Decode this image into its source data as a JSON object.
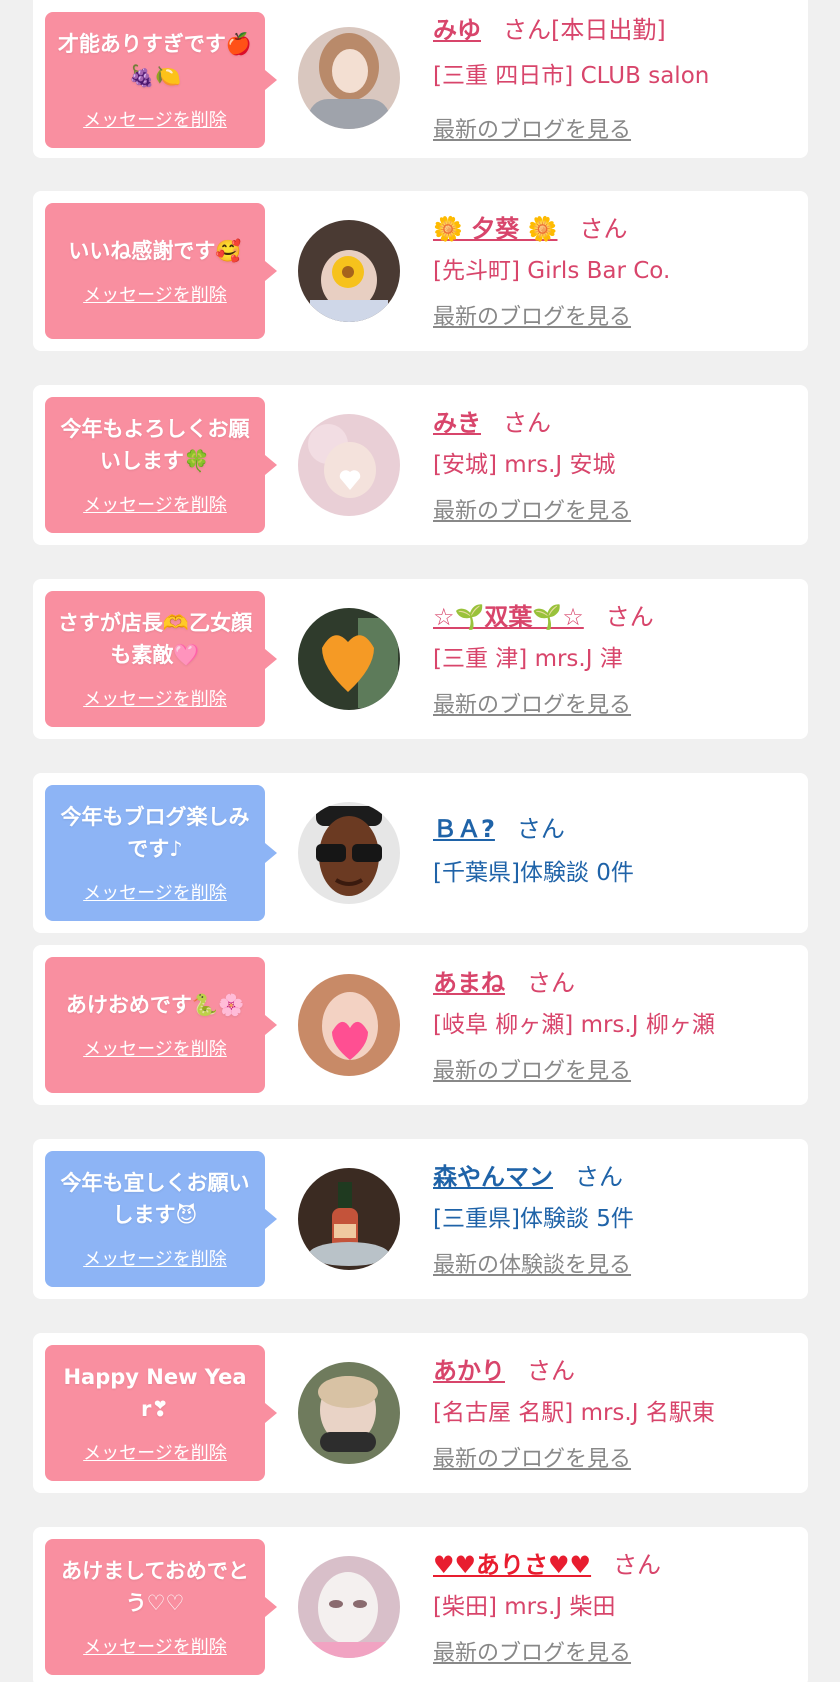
{
  "messages": [
    {
      "bubble_text": "才能ありすぎです🍎🍇🍋",
      "bubble_color": "pink",
      "delete_label": "メッセージを削除",
      "name": "みゆ",
      "honorific": "さん[本日出勤]",
      "shop": "[三重 四日市] CLUB salon",
      "link": "最新のブログを見る",
      "avatar_icon": "woman-photo-icon"
    },
    {
      "bubble_text": "いいね感謝です🥰",
      "bubble_color": "pink",
      "delete_label": "メッセージを削除",
      "name": "🌼 夕葵 🌼",
      "honorific": "さん",
      "shop": "[先斗町] Girls Bar Co.",
      "link": "最新のブログを見る",
      "avatar_icon": "flower-face-photo-icon"
    },
    {
      "bubble_text": "今年もよろしくお願いします🍀",
      "bubble_color": "pink",
      "delete_label": "メッセージを削除",
      "name": "みき",
      "honorific": "さん",
      "shop": "[安城] mrs.J 安城",
      "link": "最新のブログを見る",
      "avatar_icon": "heart-face-photo-icon"
    },
    {
      "bubble_text": "さすが店長🫶乙女顔も素敵🩷",
      "bubble_color": "pink",
      "delete_label": "メッセージを削除",
      "name": "☆🌱双葉🌱☆",
      "honorific": "さん",
      "shop": "[三重 津] mrs.J 津",
      "link": "最新のブログを見る",
      "avatar_icon": "orange-heart-photo-icon"
    },
    {
      "bubble_text": "今年もブログ楽しみです♪",
      "bubble_color": "blue",
      "delete_label": "メッセージを削除",
      "name": "ＢＡ?",
      "honorific": "さん",
      "shop": "[千葉県]体験談 0件",
      "link": "",
      "avatar_icon": "sunglasses-man-icon"
    },
    {
      "bubble_text": "あけおめです🐍🌸",
      "bubble_color": "pink",
      "delete_label": "メッセージを削除",
      "name": "あまね",
      "honorific": "さん",
      "shop": "[岐阜 柳ヶ瀬] mrs.J 柳ヶ瀬",
      "link": "最新のブログを見る",
      "avatar_icon": "pink-heart-photo-icon"
    },
    {
      "bubble_text": "今年も宜しくお願いします😈",
      "bubble_color": "blue",
      "delete_label": "メッセージを削除",
      "name": "森やんマン",
      "honorific": "さん",
      "shop": "[三重県]体験談 5件",
      "link": "最新の体験談を見る",
      "avatar_icon": "champagne-photo-icon"
    },
    {
      "bubble_text": "Happy New Year❣",
      "bubble_color": "pink",
      "delete_label": "メッセージを削除",
      "name": "あかり",
      "honorific": "さん",
      "shop": "[名古屋 名駅] mrs.J 名駅東",
      "link": "最新のブログを見る",
      "avatar_icon": "woman-photo-icon"
    },
    {
      "bubble_text": "あけましておめでとう♡♡",
      "bubble_color": "pink",
      "delete_label": "メッセージを削除",
      "name": "♥♥ありさ♥♥",
      "honorific": "さん",
      "shop": "[柴田] mrs.J 柴田",
      "link": "最新のブログを見る",
      "avatar_icon": "mask-face-photo-icon"
    }
  ],
  "colors": {
    "pink_bubble": "#f98fa0",
    "blue_bubble": "#8db4f5",
    "pink_text": "#d8456b",
    "blue_text": "#1f63a8",
    "link_gray": "#888888",
    "background": "#f0f0f0",
    "card": "#ffffff"
  }
}
